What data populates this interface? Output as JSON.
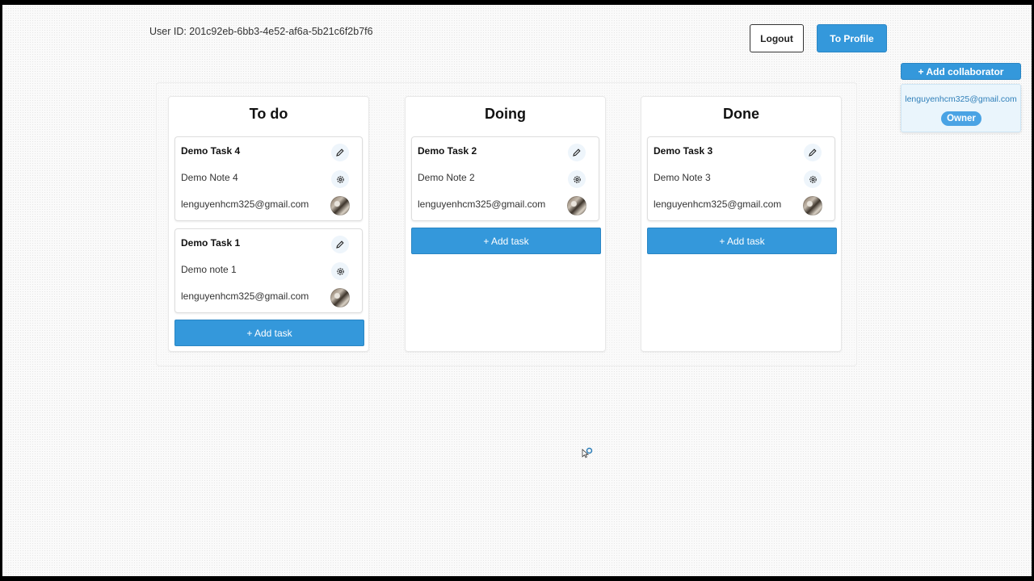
{
  "user_id_label": "User ID: 201c92eb-6bb3-4e52-af6a-5b21c6f2b7f6",
  "header": {
    "logout_label": "Logout",
    "profile_label": "To Profile"
  },
  "collaborators": {
    "add_label": "+ Add collaborator",
    "items": [
      {
        "email": "lenguyenhcm325@gmail.com",
        "role": "Owner"
      }
    ]
  },
  "columns": [
    {
      "title": "To do",
      "add_label": "+ Add task",
      "tasks": [
        {
          "title": "Demo Task 4",
          "note": "Demo Note 4",
          "assignee": "lenguyenhcm325@gmail.com"
        },
        {
          "title": "Demo Task 1",
          "note": "Demo note 1",
          "assignee": "lenguyenhcm325@gmail.com"
        }
      ]
    },
    {
      "title": "Doing",
      "add_label": "+ Add task",
      "tasks": [
        {
          "title": "Demo Task 2",
          "note": "Demo Note 2",
          "assignee": "lenguyenhcm325@gmail.com"
        }
      ]
    },
    {
      "title": "Done",
      "add_label": "+ Add task",
      "tasks": [
        {
          "title": "Demo Task 3",
          "note": "Demo Note 3",
          "assignee": "lenguyenhcm325@gmail.com"
        }
      ]
    }
  ],
  "colors": {
    "accent": "#3498db",
    "owner_badge": "#4aa3e4",
    "collab_email": "#2f7fb9"
  },
  "icons": [
    "edit-icon",
    "settings-icon",
    "avatar",
    "loading-cursor-icon"
  ]
}
